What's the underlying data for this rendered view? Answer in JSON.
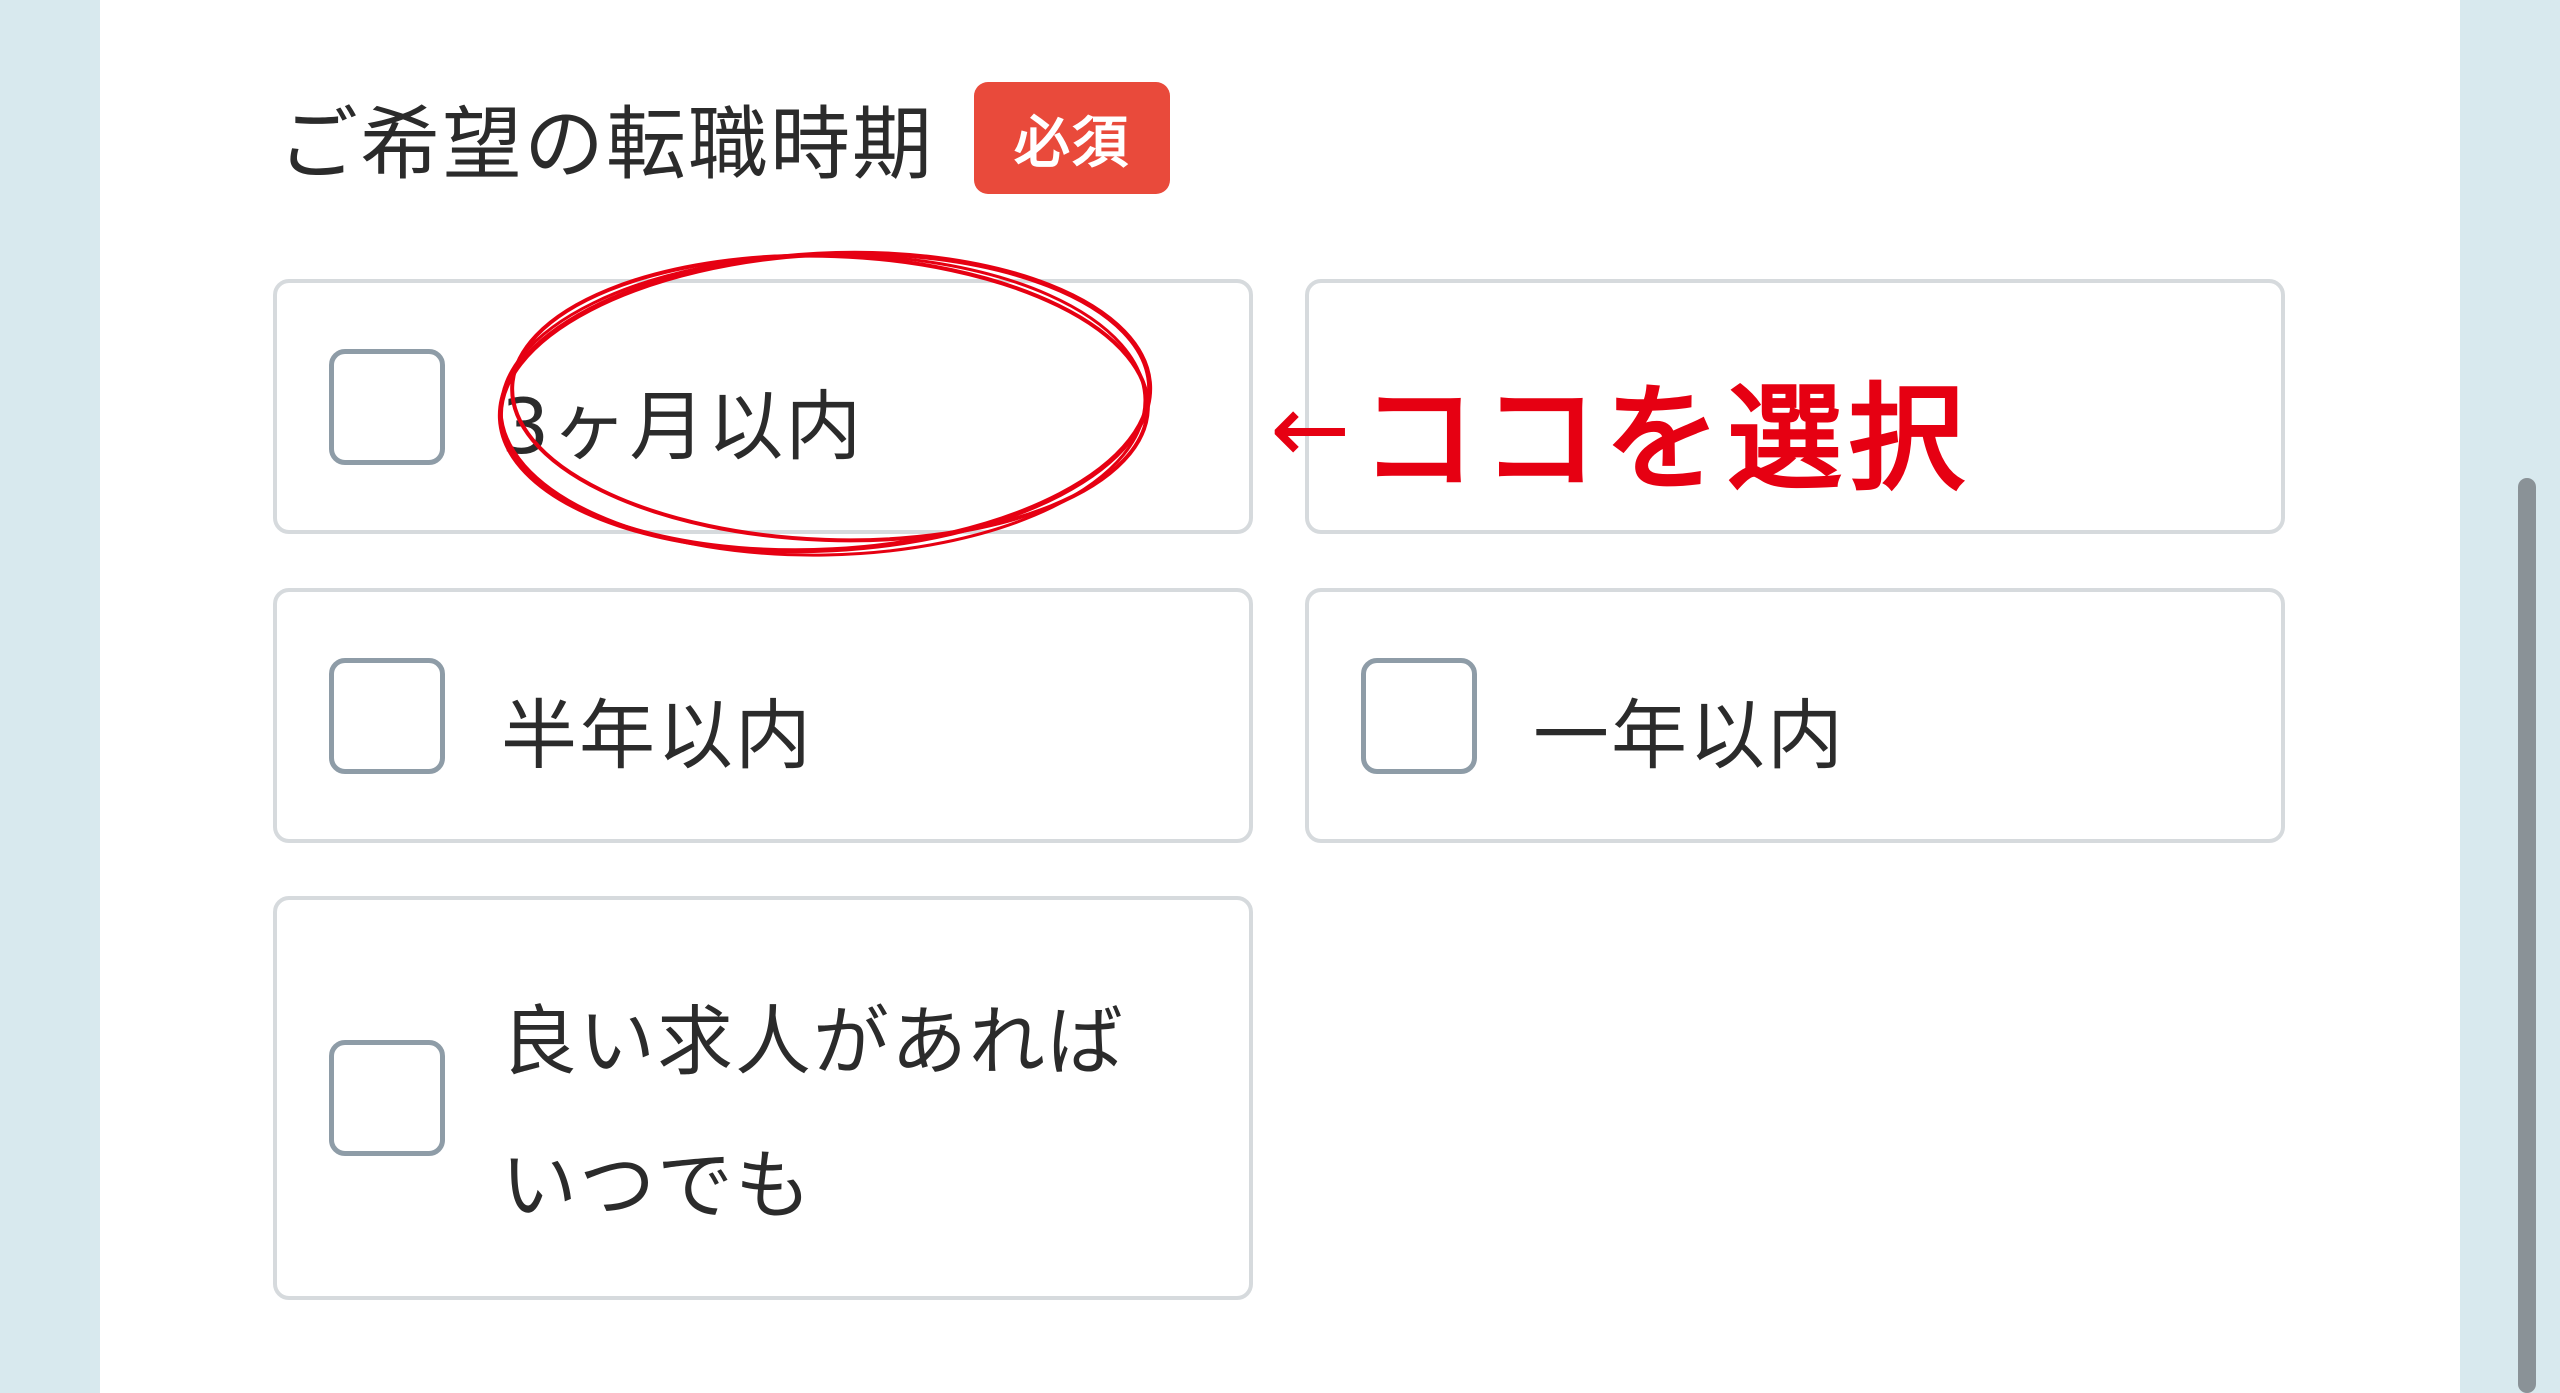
{
  "form": {
    "question_label": "ご希望の転職時期",
    "required_badge": "必須"
  },
  "options": [
    {
      "label": "3ヶ月以内",
      "checked": false
    },
    {
      "label": "",
      "checked": false
    },
    {
      "label": "半年以内",
      "checked": false
    },
    {
      "label": "一年以内",
      "checked": false
    },
    {
      "label": "良い求人があればいつでも",
      "checked": false
    }
  ],
  "annotation": {
    "arrow": "←",
    "text": "ココを選択",
    "color": "#e60012"
  },
  "colors": {
    "badge": "#e94a3b",
    "background": "#d8e9ee",
    "checkbox_border": "#8e9ca7"
  }
}
